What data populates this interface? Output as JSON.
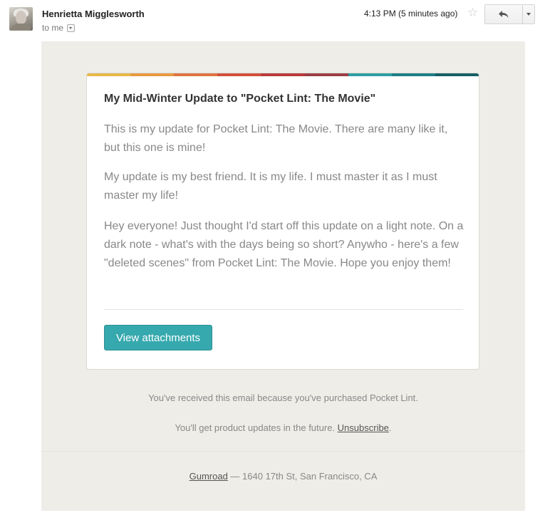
{
  "header": {
    "sender_name": "Henrietta Migglesworth",
    "recipient": "to me",
    "time": "4:13 PM (5 minutes ago)",
    "star_icon": "star-outline-icon",
    "reply_icon": "reply-arrow-icon",
    "more_icon": "chevron-down-icon"
  },
  "email": {
    "stripe_colors": [
      "#e8b84a",
      "#e79a41",
      "#e1733f",
      "#d2503a",
      "#b93a3b",
      "#9a3e45",
      "#2b9ea2",
      "#1d7e86",
      "#165f64"
    ],
    "title": "My Mid-Winter Update to \"Pocket Lint: The Movie\"",
    "paragraphs": [
      "This is my update for Pocket Lint: The Movie. There are many like it, but this one is mine!",
      "My update is my best friend. It is my life. I must master it as I must master my life!",
      "Hey everyone! Just thought I'd start off this update on a light note. On a dark note - what's with the days being so short? Anywho - here's a few \"deleted scenes\" from Pocket Lint: The Movie. Hope you enjoy them!"
    ],
    "attachments_button": "View attachments",
    "accent_color": "#36a9ae"
  },
  "notice": {
    "received_reason": "You've received this email because you've purchased Pocket Lint.",
    "updates_text": "You'll get product updates in the future. ",
    "unsubscribe_label": "Unsubscribe",
    "period": "."
  },
  "footer": {
    "brand_link": "Gumroad",
    "address": " — 1640 17th St, San Francisco, CA"
  }
}
